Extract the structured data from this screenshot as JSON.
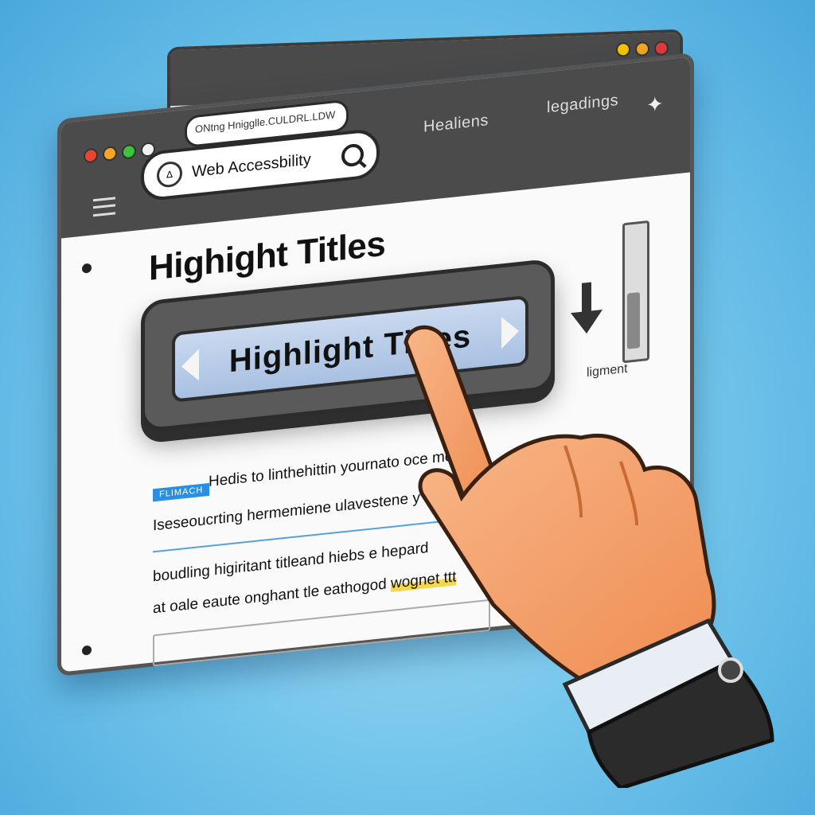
{
  "back_window": {
    "traffic_lights": [
      "#f5c400",
      "#f5a623",
      "#e23b3b"
    ],
    "traffic_lights_2": [
      "#3cc43c",
      "#e23b3b",
      "#e23b3b"
    ]
  },
  "browser": {
    "traffic_lights": [
      "#e8442e",
      "#f5a623",
      "#3cc43c",
      "#f0f0f0"
    ],
    "url_chip": "ONtng Hnigglle.CULDRL.LDW",
    "search": {
      "logo": "Δ",
      "value": "Web Accessbility"
    },
    "nav": [
      "Healiens",
      "legadings"
    ],
    "puzzle_icon": "✦"
  },
  "page": {
    "title": "Highight Titles",
    "button_label": "Highlight Titles",
    "side_note": "ligment",
    "badge": "FLIMACH",
    "lines": [
      "Hedis to linthehittin yournato oce melis",
      "Iseseoucrting hermemiene ulavestene y",
      "boudling higiritant titleand hiebs e hepard",
      "at oale eaute onghant tle eathogod wognet ttt"
    ],
    "highlighted": [
      "c hepard",
      "wognet ttt"
    ]
  },
  "colors": {
    "accent": "#2a8fe0",
    "highlight": "#f5d74a",
    "button_face": "#a8c0e2",
    "skin": "#f5a06a",
    "cuff": "#2b2b2b"
  }
}
